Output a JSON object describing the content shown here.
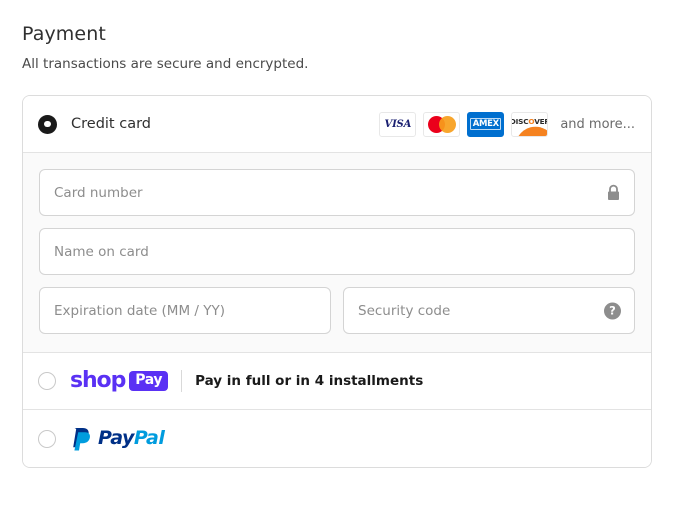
{
  "section": {
    "title": "Payment",
    "subtitle": "All transactions are secure and encrypted."
  },
  "credit_card": {
    "label": "Credit card",
    "selected": true,
    "brands": [
      {
        "name": "visa-logo",
        "text": "VISA"
      },
      {
        "name": "mastercard-logo",
        "text": ""
      },
      {
        "name": "amex-logo",
        "text": "AMEX"
      },
      {
        "name": "discover-logo",
        "text_before": "DISC",
        "text_highlight": "O",
        "text_after": "VER"
      }
    ],
    "more_label": "and more...",
    "fields": {
      "card_number": {
        "placeholder": "Card number",
        "value": "",
        "icon": "lock-icon"
      },
      "name_on_card": {
        "placeholder": "Name on card",
        "value": ""
      },
      "expiration": {
        "placeholder": "Expiration date (MM / YY)",
        "value": ""
      },
      "security_code": {
        "placeholder": "Security code",
        "value": "",
        "icon": "help-icon",
        "icon_glyph": "?"
      }
    }
  },
  "shop_pay": {
    "selected": false,
    "logo_word": "shop",
    "logo_badge": "Pay",
    "description": "Pay in full or in 4 installments",
    "brand_color": "#5A31F4"
  },
  "paypal": {
    "selected": false,
    "logo_text_dark": "Pay",
    "logo_text_light": "Pal",
    "brand_color_dark": "#003087",
    "brand_color_light": "#009CDE"
  }
}
